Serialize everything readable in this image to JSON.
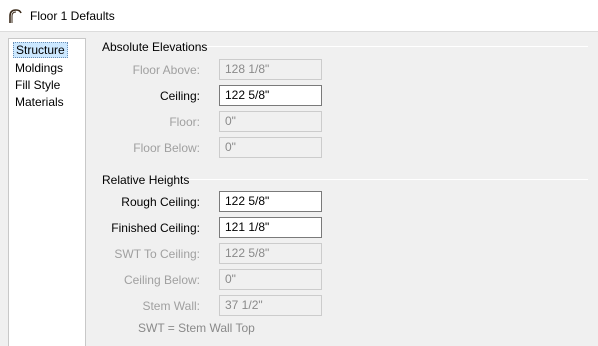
{
  "window": {
    "title": "Floor 1 Defaults",
    "icon": "arch-icon"
  },
  "sidebar": {
    "items": [
      {
        "label": "Structure",
        "selected": true
      },
      {
        "label": "Moldings"
      },
      {
        "label": "Fill Style"
      },
      {
        "label": "Materials"
      }
    ]
  },
  "absolute_elevations": {
    "title": "Absolute Elevations",
    "floor_above": {
      "label": "Floor Above:",
      "value": "128 1/8\"",
      "enabled": false
    },
    "ceiling": {
      "label": "Ceiling:",
      "value": "122 5/8\"",
      "enabled": true
    },
    "floor": {
      "label": "Floor:",
      "value": "0\"",
      "enabled": false
    },
    "floor_below": {
      "label": "Floor Below:",
      "value": "0\"",
      "enabled": false
    }
  },
  "relative_heights": {
    "title": "Relative Heights",
    "rough_ceiling": {
      "label": "Rough Ceiling:",
      "value": "122 5/8\"",
      "enabled": true
    },
    "finished_ceiling": {
      "label": "Finished Ceiling:",
      "value": "121 1/8\"",
      "enabled": true
    },
    "swt_to_ceiling": {
      "label": "SWT To Ceiling:",
      "value": "122 5/8\"",
      "enabled": false
    },
    "ceiling_below": {
      "label": "Ceiling Below:",
      "value": "0\"",
      "enabled": false
    },
    "stem_wall": {
      "label": "Stem Wall:",
      "value": "37 1/2\"",
      "enabled": false
    },
    "note": "SWT = Stem Wall Top"
  }
}
